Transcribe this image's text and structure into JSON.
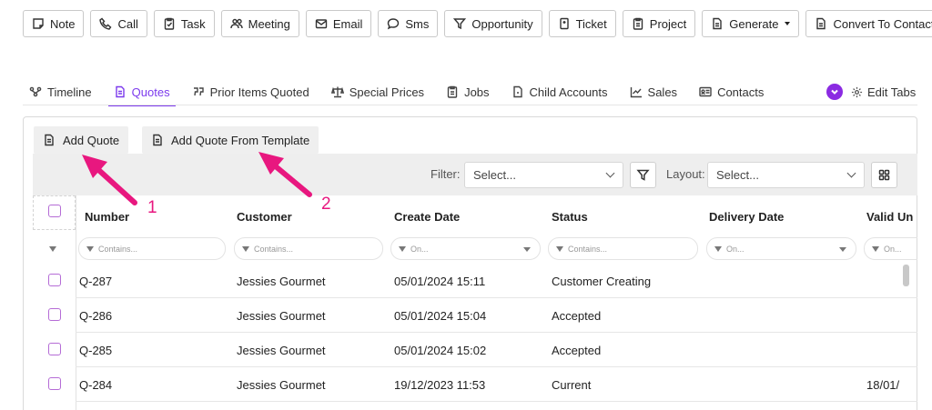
{
  "actions": [
    {
      "label": "Note",
      "icon": "note-icon"
    },
    {
      "label": "Call",
      "icon": "phone-icon"
    },
    {
      "label": "Task",
      "icon": "clipboard-check-icon"
    },
    {
      "label": "Meeting",
      "icon": "people-icon"
    },
    {
      "label": "Email",
      "icon": "envelope-icon"
    },
    {
      "label": "Sms",
      "icon": "chat-bubble-icon"
    },
    {
      "label": "Opportunity",
      "icon": "funnel-icon"
    },
    {
      "label": "Ticket",
      "icon": "ticket-icon"
    },
    {
      "label": "Project",
      "icon": "clipboard-icon"
    },
    {
      "label": "Generate",
      "icon": "document-icon"
    },
    {
      "label": "Convert To Contact",
      "icon": "document-icon"
    }
  ],
  "tabs": [
    {
      "label": "Timeline",
      "icon": "timeline-icon",
      "active": false
    },
    {
      "label": "Quotes",
      "icon": "document-icon",
      "active": true
    },
    {
      "label": "Prior Items Quoted",
      "icon": "quote-marks-icon",
      "active": false
    },
    {
      "label": "Special Prices",
      "icon": "scale-icon",
      "active": false
    },
    {
      "label": "Jobs",
      "icon": "clipboard-icon",
      "active": false
    },
    {
      "label": "Child Accounts",
      "icon": "file-icon",
      "active": false
    },
    {
      "label": "Sales",
      "icon": "chart-line-icon",
      "active": false
    },
    {
      "label": "Contacts",
      "icon": "contact-card-icon",
      "active": false
    }
  ],
  "edit_tabs_label": "Edit Tabs",
  "quote_buttons": {
    "add_quote": "Add Quote",
    "add_from_template": "Add Quote From Template"
  },
  "filterbar": {
    "filter_label": "Filter:",
    "filter_placeholder": "Select...",
    "layout_label": "Layout:",
    "layout_placeholder": "Select..."
  },
  "columns": [
    "Number",
    "Customer",
    "Create Date",
    "Status",
    "Delivery Date",
    "Valid Un"
  ],
  "column_filters": [
    "Contains...",
    "Contains...",
    "On...",
    "Contains...",
    "On...",
    "On..."
  ],
  "rows": [
    {
      "number": "Q-287",
      "customer": "Jessies Gourmet",
      "create_date": "05/01/2024 15:11",
      "status": "Customer Creating",
      "delivery_date": "",
      "valid_until": ""
    },
    {
      "number": "Q-286",
      "customer": "Jessies Gourmet",
      "create_date": "05/01/2024 15:04",
      "status": "Accepted",
      "delivery_date": "",
      "valid_until": ""
    },
    {
      "number": "Q-285",
      "customer": "Jessies Gourmet",
      "create_date": "05/01/2024 15:02",
      "status": "Accepted",
      "delivery_date": "",
      "valid_until": ""
    },
    {
      "number": "Q-284",
      "customer": "Jessies Gourmet",
      "create_date": "19/12/2023 11:53",
      "status": "Current",
      "delivery_date": "",
      "valid_until": "18/01/"
    }
  ],
  "annotations": {
    "label_1": "1",
    "label_2": "2",
    "color": "#e8177f"
  },
  "colors": {
    "accent": "#7c3aed",
    "checkbox": "#b56cd6",
    "annotation": "#e8177f"
  }
}
